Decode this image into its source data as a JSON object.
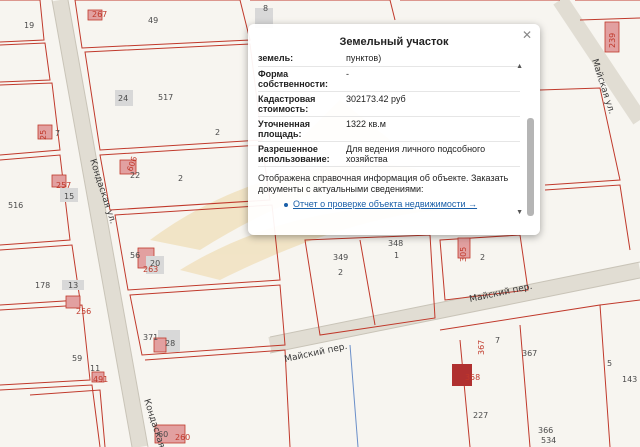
{
  "map": {
    "parcel_labels": [
      "19",
      "267",
      "49",
      "8",
      "239",
      "24",
      "517",
      "2",
      "25",
      "7",
      "606",
      "22",
      "2",
      "257",
      "516",
      "15",
      "178",
      "13",
      "256",
      "56",
      "20",
      "263",
      "349",
      "2",
      "348",
      "1",
      "305",
      "2",
      "371",
      "28",
      "59",
      "11",
      "491",
      "367",
      "367",
      "7",
      "358",
      "5",
      "143",
      "227",
      "366",
      "534",
      "60",
      "260"
    ],
    "street_labels": [
      "Кондаская ул.",
      "Майская ул.",
      "Майский пер.",
      "Майский пер.",
      "Кондаская"
    ]
  },
  "popup": {
    "title": "Земельный участок",
    "close_icon": "close-icon",
    "partial_top": {
      "key": "земель:",
      "value": "пунктов)"
    },
    "rows": [
      {
        "key": "Форма собственности:",
        "value": "-"
      },
      {
        "key": "Кадастровая стоимость:",
        "value": "302173.42 руб"
      },
      {
        "key": "Уточненная площадь:",
        "value": "1322 кв.м"
      },
      {
        "key": "Разрешенное использование:",
        "value": "Для ведения личного подсобного хозяйства"
      }
    ],
    "note": "Отображена справочная информация об объекте. Заказать документы с актуальными сведениями:",
    "link_text": "Отчет о проверке объекта недвижимости →"
  }
}
